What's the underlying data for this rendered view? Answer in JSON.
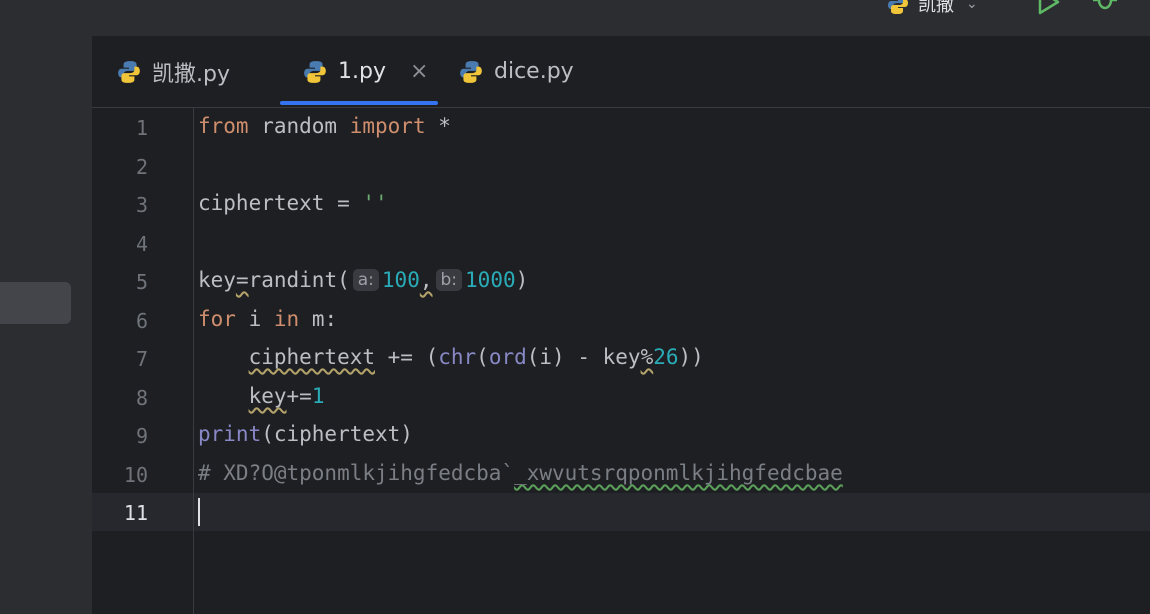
{
  "topbar": {
    "run_config_label": "凯撒",
    "run_icon": "play-icon",
    "debug_icon": "bug-icon",
    "file_icon": "python-icon"
  },
  "tabs": [
    {
      "label": "凯撒.py",
      "icon": "python-icon",
      "active": false
    },
    {
      "label": "1.py",
      "icon": "python-icon",
      "active": true,
      "close": "×"
    },
    {
      "label": "dice.py",
      "icon": "python-icon",
      "active": false
    }
  ],
  "editor": {
    "current_line": 11,
    "line_numbers": [
      "1",
      "2",
      "3",
      "4",
      "5",
      "6",
      "7",
      "8",
      "9",
      "10",
      "11"
    ],
    "lines": {
      "l1": {
        "kw1": "from",
        "mod": " random ",
        "kw2": "import",
        "rest": " *"
      },
      "l3": {
        "var": "ciphertext = ",
        "str": "''"
      },
      "l5": {
        "key": "key",
        "eq": "=",
        "fn": "randint(",
        "hint_a": "a:",
        "a": "100",
        "comma": ",",
        "hint_b": "b:",
        "b": "1000",
        "close": ")"
      },
      "l6": {
        "kw1": "for",
        "i": " i ",
        "kw2": "in",
        "rest": " m:"
      },
      "l7": {
        "indent": "    ",
        "var": "ciphertext",
        "op": " += (",
        "chr": "chr",
        "p1": "(",
        "ord": "ord",
        "p2": "(i) - ",
        "key": "key",
        "mod": "%",
        "num": "26",
        "close": "))"
      },
      "l8": {
        "indent": "    ",
        "var": "key",
        "op": "+=",
        "num": "1"
      },
      "l9": {
        "fn": "print",
        "rest": "(ciphertext)"
      },
      "l10": {
        "c1": "# XD?O@tponmlkjihgfedcba`",
        "c2": "_xwvutsrqponmlkjihgfedcbae"
      }
    }
  },
  "colors": {
    "keyword": "#cf8e6d",
    "builtin": "#8888c6",
    "number": "#2aacb8",
    "string": "#6aab73",
    "comment": "#7a7e85",
    "accent": "#3574f0"
  }
}
